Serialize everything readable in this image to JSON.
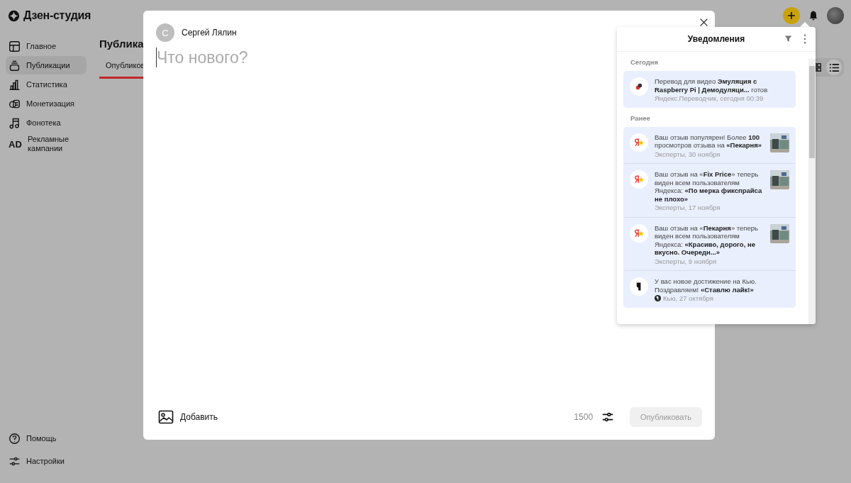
{
  "brand": {
    "name": "Дзен-студия"
  },
  "sidebar": {
    "items": [
      {
        "label": "Главное",
        "selected": false
      },
      {
        "label": "Публикации",
        "selected": true
      },
      {
        "label": "Статистика",
        "selected": false
      },
      {
        "label": "Монетизация",
        "selected": false
      },
      {
        "label": "Фонотека",
        "selected": false
      },
      {
        "label": "Рекламные кампании",
        "selected": false
      }
    ],
    "bottom_items": [
      {
        "label": "Помощь"
      },
      {
        "label": "Настройки"
      }
    ],
    "ad_mark": "AD"
  },
  "page": {
    "heading": "Публика",
    "tabs": [
      {
        "label": "Опубликов",
        "selected": true
      }
    ],
    "views": [
      {
        "selected": false
      },
      {
        "selected": true
      }
    ]
  },
  "composer": {
    "author": "Сергей Лялин",
    "avatar_letter": "С",
    "placeholder": "Что нового?",
    "add_label": "Добавить",
    "char_limit": "1500",
    "publish_button": {
      "label": "Опубликовать",
      "disabled": true
    }
  },
  "notifications": {
    "title": "Уведомления",
    "sections": [
      {
        "title": "Сегодня",
        "items": [
          {
            "kind": "translator",
            "text": "Перевод для видео **Эмуляция с Raspberry Pi | Демодуляци...** готов",
            "meta": "Яндекс.Переводчик, сегодня 00:39",
            "thumbnail": false
          }
        ]
      },
      {
        "title": "Ранее",
        "items": [
          {
            "kind": "yandex",
            "text": "Ваш отзыв популярен! Более **100** просмотров отзыва на **«Пекарня»**",
            "meta": "Эксперты, 30 ноября",
            "thumbnail": true
          },
          {
            "kind": "yandex",
            "text": "Ваш отзыв на «**Fix Price**» теперь виден всем пользователям Яндекса: **«По мерка фикспрайса не плохо»**",
            "meta": "Эксперты, 17 ноября",
            "thumbnail": true
          },
          {
            "kind": "yandex",
            "text": "Ваш отзыв на «**Пекарня**» теперь виден всем пользователям Яндекса: **«Красиво, дорого, не вкусно. Очередн...»**",
            "meta": "Эксперты, 9 ноября",
            "thumbnail": true
          },
          {
            "kind": "q",
            "text": "У вас новое достижение на Кью. Поздравляем! **«Ставлю лайк!»**",
            "meta": "Кью, 27 октября",
            "thumbnail": false
          }
        ]
      }
    ]
  }
}
